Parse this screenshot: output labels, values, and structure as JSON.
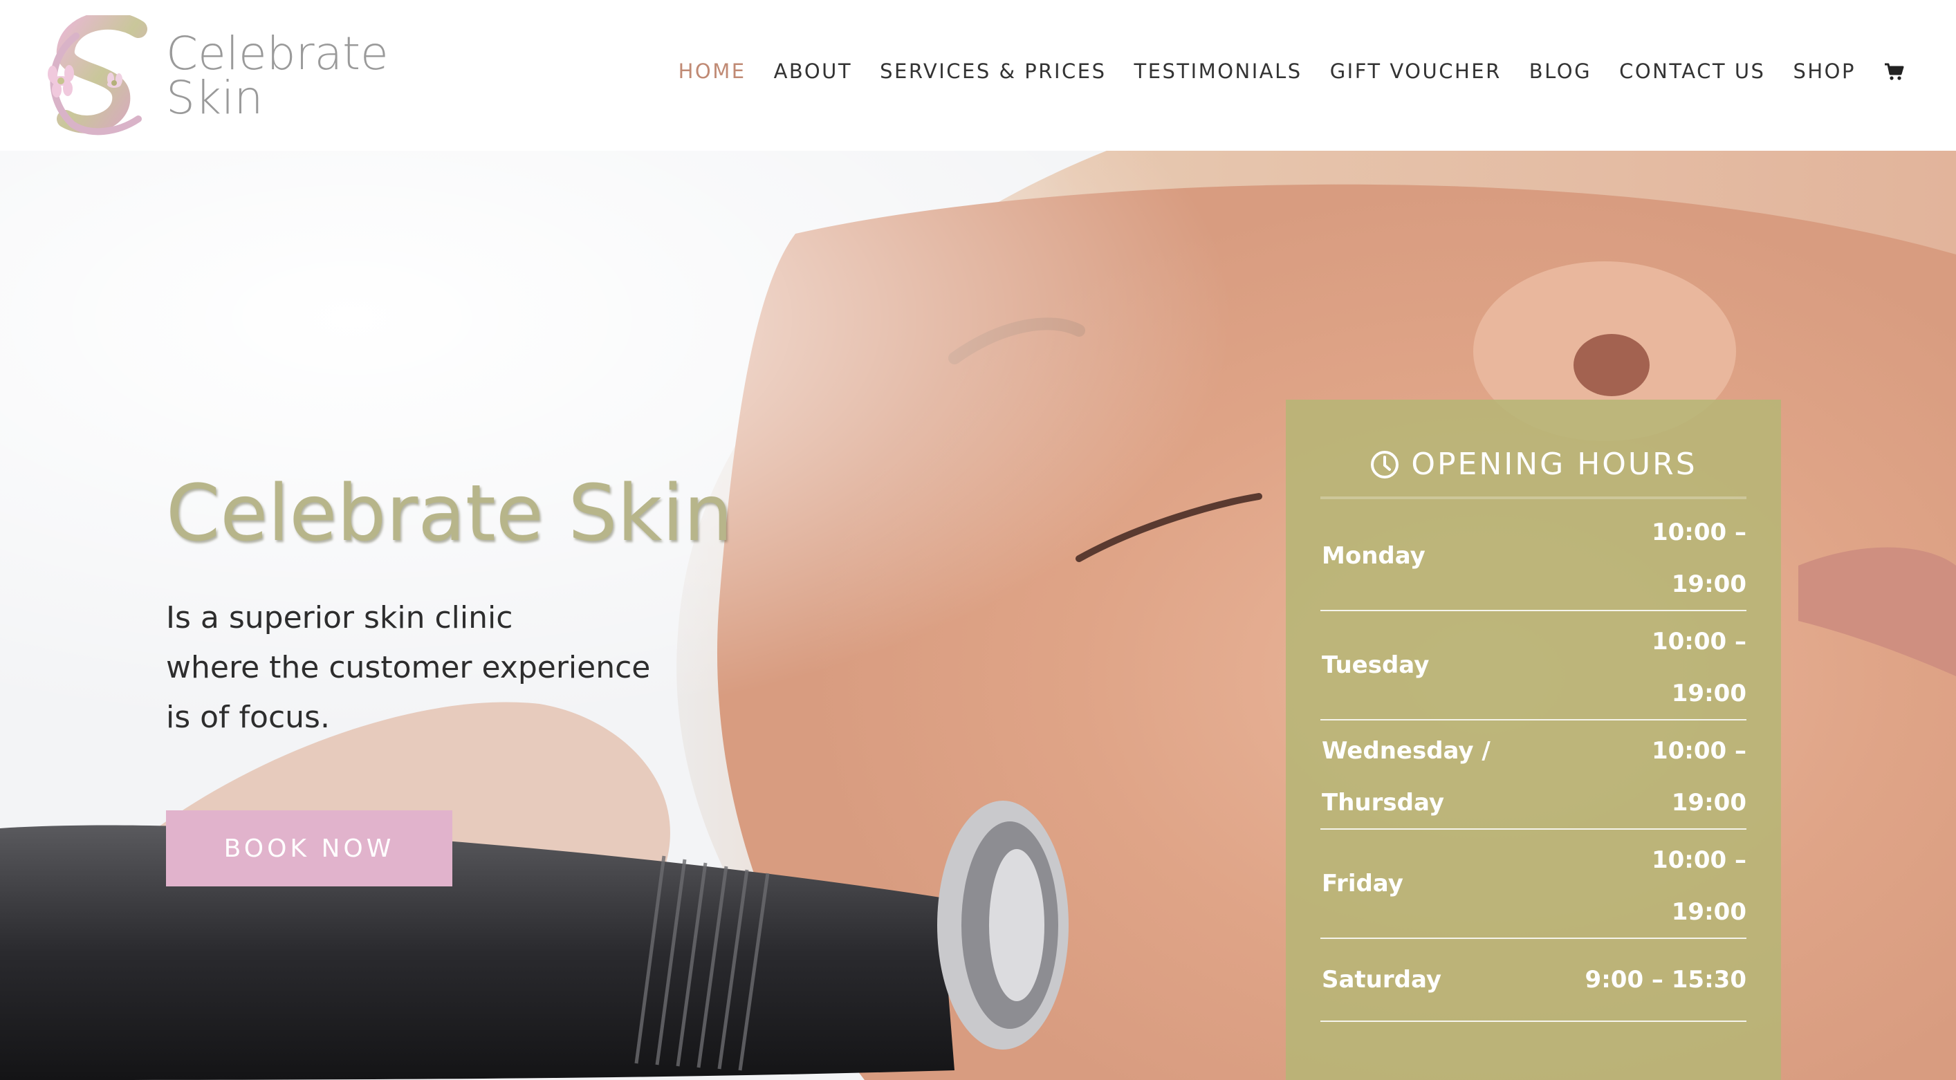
{
  "brand": {
    "name_line1": "Celebrate",
    "name_line2": "Skin"
  },
  "nav": {
    "items": [
      {
        "label": "HOME",
        "active": true
      },
      {
        "label": "ABOUT"
      },
      {
        "label": "SERVICES & PRICES"
      },
      {
        "label": "TESTIMONIALS"
      },
      {
        "label": "GIFT VOUCHER"
      },
      {
        "label": "BLOG"
      },
      {
        "label": "CONTACT US"
      },
      {
        "label": "SHOP"
      }
    ],
    "cart_icon": "cart-icon"
  },
  "hero": {
    "title": "Celebrate Skin",
    "text_lines": [
      "Is a superior skin clinic",
      "where the customer experience",
      "is of focus."
    ],
    "button": "BOOK NOW"
  },
  "hours": {
    "title": "OPENING HOURS",
    "icon": "clock-icon",
    "rows": [
      {
        "day": "Monday",
        "time_line1": "10:00 –",
        "time_line2": "19:00"
      },
      {
        "day": "Tuesday",
        "time_line1": "10:00 –",
        "time_line2": "19:00"
      },
      {
        "day_line1": "Wednesday /",
        "day_line2": "Thursday",
        "time_line1": "10:00 –",
        "time_line2": "19:00"
      },
      {
        "day": "Friday",
        "time_line1": "10:00 –",
        "time_line2": "19:00"
      },
      {
        "day": "Saturday",
        "time": "9:00 – 15:30"
      }
    ]
  },
  "colors": {
    "accent_nav_active": "#c08a74",
    "title_olive": "#b7b58a",
    "button_pink": "#e1b3cc",
    "hours_panel": "#b6b676"
  }
}
